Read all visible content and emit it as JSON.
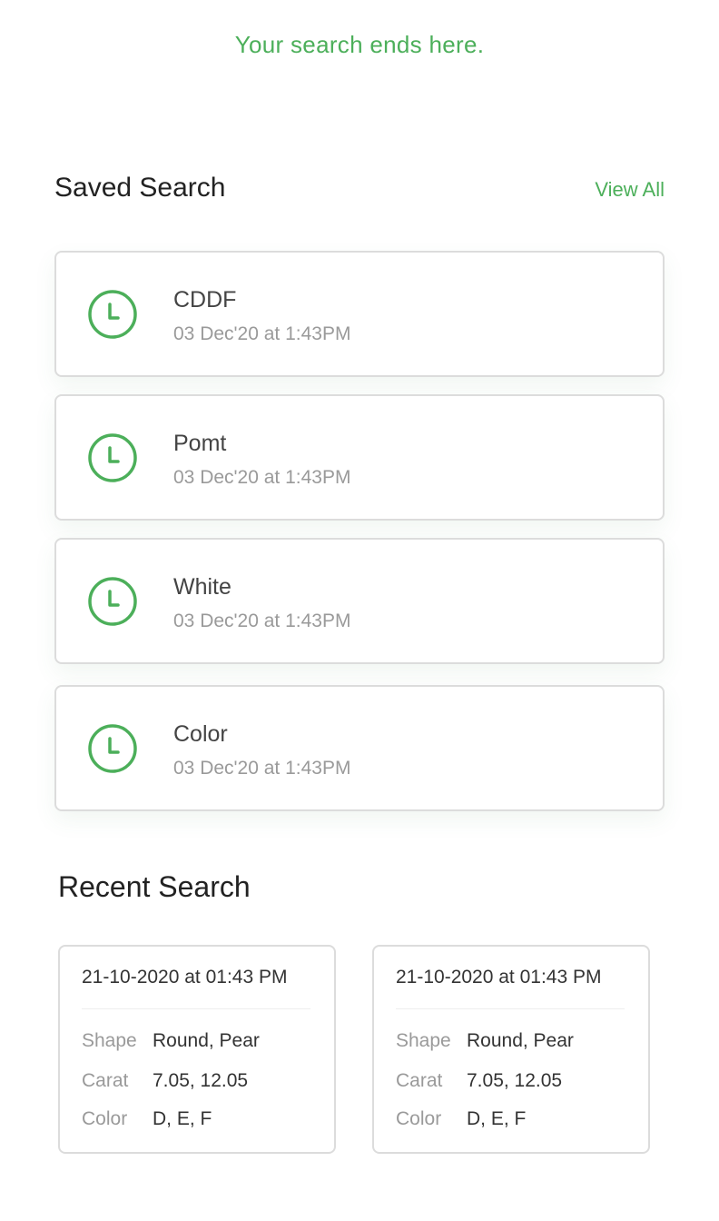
{
  "tagline": "Your search ends here.",
  "saved": {
    "title": "Saved Search",
    "view_all": "View All",
    "items": [
      {
        "name": "CDDF",
        "date": "03 Dec'20 at 1:43PM"
      },
      {
        "name": "Pomt",
        "date": "03 Dec'20 at 1:43PM"
      },
      {
        "name": "White",
        "date": "03 Dec'20 at 1:43PM"
      },
      {
        "name": "Color",
        "date": "03 Dec'20 at 1:43PM"
      }
    ]
  },
  "recent": {
    "title": "Recent Search",
    "cards": [
      {
        "date": "21-10-2020 at 01:43 PM",
        "shape_label": "Shape",
        "shape": "Round, Pear",
        "carat_label": "Carat",
        "carat": "7.05, 12.05",
        "color_label": "Color",
        "color": "D, E, F"
      },
      {
        "date": "21-10-2020 at 01:43 PM",
        "shape_label": "Shape",
        "shape": "Round, Pear",
        "carat_label": "Carat",
        "carat": "7.05, 12.05",
        "color_label": "Color",
        "color": "D, E, F"
      }
    ]
  },
  "colors": {
    "accent": "#4caf5a",
    "border": "#dcdcdc",
    "muted": "#9a9a9a"
  },
  "icons": {
    "saved_item": "clock-icon"
  }
}
